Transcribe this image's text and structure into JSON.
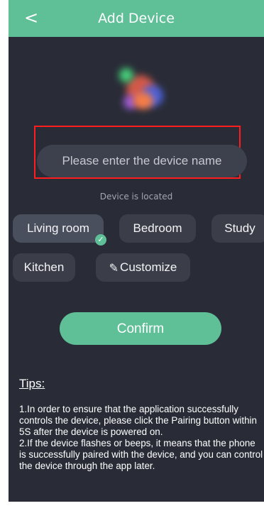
{
  "header": {
    "back_icon": "<",
    "title": "Add Device"
  },
  "device": {
    "image_icon": "device-image-icon",
    "name_placeholder": "Please enter the device name"
  },
  "location": {
    "label": "Device is located",
    "options": [
      "Living room",
      "Bedroom",
      "Study",
      "Kitchen",
      "Customize"
    ],
    "selected": "Living room"
  },
  "actions": {
    "confirm_label": "Confirm"
  },
  "tips": {
    "title": "Tips:",
    "items": [
      "1.In order to ensure that the application successfully controls the device, please click the Pairing button within 5S after the device is powered on.",
      "2.If the device flashes or beeps, it means that the phone is successfully paired with the device, and you can control the device through the app later."
    ]
  },
  "colors": {
    "header": "#5fbf97",
    "background": "#292c37",
    "accent": "#5fbf97",
    "highlight_frame": "#ff1d1d"
  }
}
